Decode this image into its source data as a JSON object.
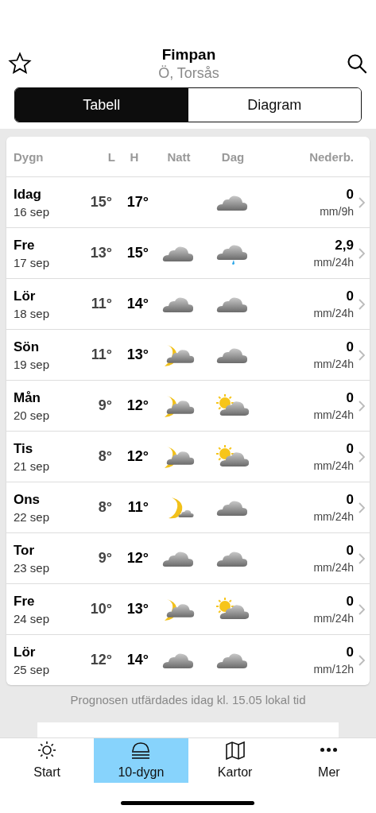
{
  "header": {
    "title": "Fimpan",
    "subtitle": "Ö, Torsås"
  },
  "segments": [
    {
      "label": "Tabell",
      "selected": true
    },
    {
      "label": "Diagram",
      "selected": false
    }
  ],
  "table": {
    "columns": [
      "Dygn",
      "L",
      "H",
      "Natt",
      "Dag",
      "Nederb."
    ],
    "rows": [
      {
        "day": "Idag",
        "date": "16 sep",
        "low": "15°",
        "high": "17°",
        "day_weather": {
          "kind": "cloud"
        },
        "precip": "0",
        "unit": "mm/9h"
      },
      {
        "day": "Fre",
        "date": "17 sep",
        "low": "13°",
        "high": "15°",
        "night_weather": {
          "kind": "cloud"
        },
        "day_weather": {
          "kind": "rain"
        },
        "precip": "2,9",
        "unit": "mm/24h"
      },
      {
        "day": "Lör",
        "date": "18 sep",
        "low": "11°",
        "high": "14°",
        "night_weather": {
          "kind": "cloud"
        },
        "day_weather": {
          "kind": "cloud"
        },
        "precip": "0",
        "unit": "mm/24h"
      },
      {
        "day": "Sön",
        "date": "19 sep",
        "low": "11°",
        "high": "13°",
        "night_weather": {
          "kind": "mooncloud"
        },
        "day_weather": {
          "kind": "cloud"
        },
        "precip": "0",
        "unit": "mm/24h"
      },
      {
        "day": "Mån",
        "date": "20 sep",
        "low": "9°",
        "high": "12°",
        "night_weather": {
          "kind": "mooncloud"
        },
        "day_weather": {
          "kind": "suncloud"
        },
        "precip": "0",
        "unit": "mm/24h"
      },
      {
        "day": "Tis",
        "date": "21 sep",
        "low": "8°",
        "high": "12°",
        "night_weather": {
          "kind": "mooncloud"
        },
        "day_weather": {
          "kind": "suncloud"
        },
        "precip": "0",
        "unit": "mm/24h"
      },
      {
        "day": "Ons",
        "date": "22 sep",
        "low": "8°",
        "high": "11°",
        "night_weather": {
          "kind": "moon"
        },
        "day_weather": {
          "kind": "cloud"
        },
        "precip": "0",
        "unit": "mm/24h"
      },
      {
        "day": "Tor",
        "date": "23 sep",
        "low": "9°",
        "high": "12°",
        "night_weather": {
          "kind": "cloud"
        },
        "day_weather": {
          "kind": "cloud"
        },
        "precip": "0",
        "unit": "mm/24h"
      },
      {
        "day": "Fre",
        "date": "24 sep",
        "low": "10°",
        "high": "13°",
        "night_weather": {
          "kind": "mooncloud"
        },
        "day_weather": {
          "kind": "suncloud"
        },
        "precip": "0",
        "unit": "mm/24h"
      },
      {
        "day": "Lör",
        "date": "25 sep",
        "low": "12°",
        "high": "14°",
        "night_weather": {
          "kind": "cloud"
        },
        "day_weather": {
          "kind": "cloud"
        },
        "precip": "0",
        "unit": "mm/12h"
      }
    ]
  },
  "issued": "Prognosen utfärdades idag kl. 15.05 lokal tid",
  "tabbar": [
    {
      "label": "Start",
      "selected": false
    },
    {
      "label": "10-dygn",
      "selected": true
    },
    {
      "label": "Kartor",
      "selected": false
    },
    {
      "label": "Mer",
      "selected": false
    }
  ]
}
